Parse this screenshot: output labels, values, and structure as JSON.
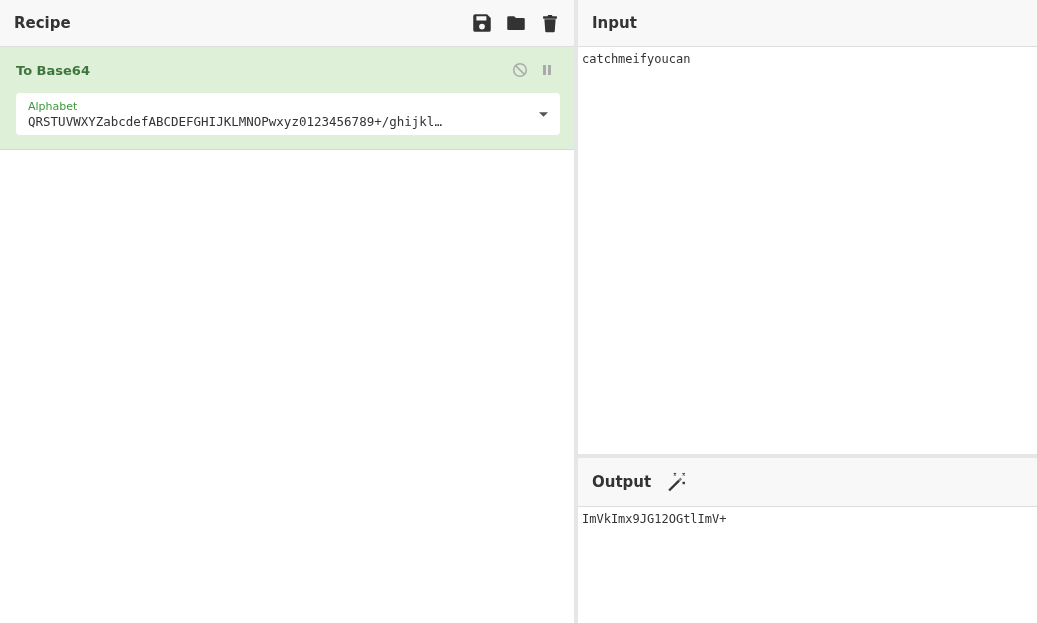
{
  "recipe": {
    "title": "Recipe",
    "operations": [
      {
        "name": "To Base64",
        "disabled": false,
        "breakpoint": false,
        "fields": [
          {
            "kind": "dropdown",
            "label": "Alphabet",
            "value": "QRSTUVWXYZabcdefABCDEFGHIJKLMNOPwxyz0123456789+/ghijkl…"
          }
        ]
      }
    ]
  },
  "input": {
    "title": "Input",
    "text": "catchmeifyoucan"
  },
  "output": {
    "title": "Output",
    "text": "ImVkImx9JG12OGtlImV+"
  }
}
